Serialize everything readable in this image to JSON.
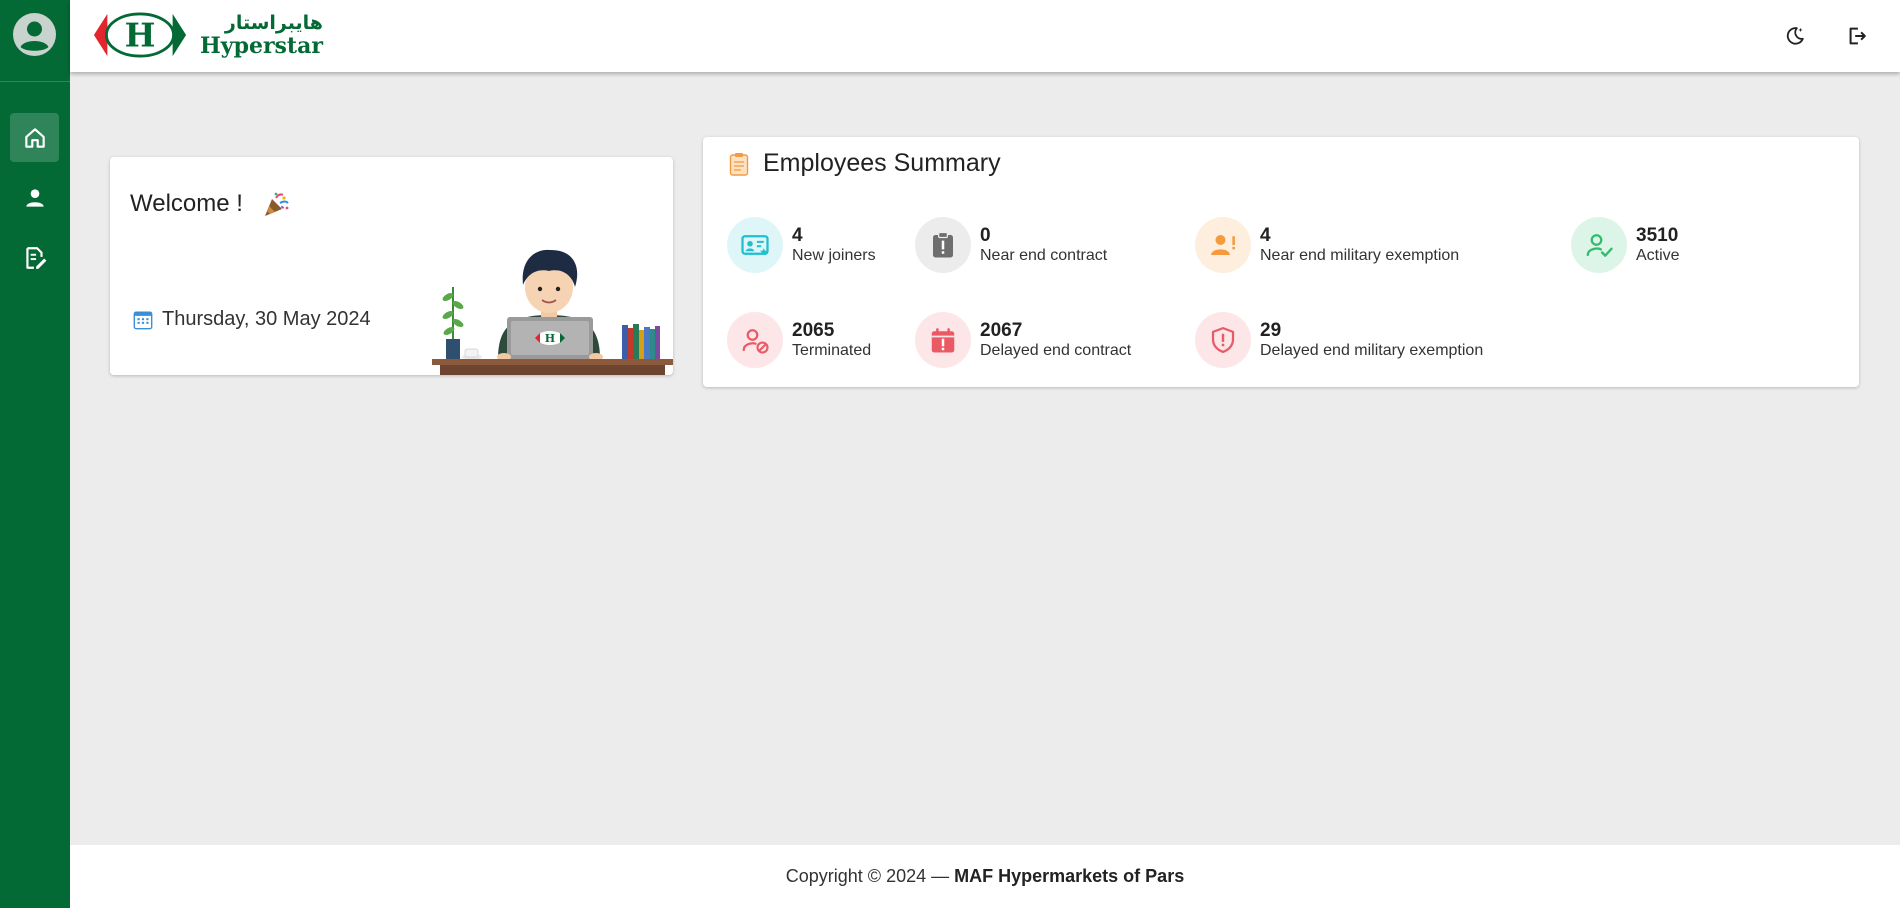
{
  "app": {
    "logo_arabic": "هايبراستار",
    "logo_latin": "Hyperstar"
  },
  "sidebar": {
    "items": [
      {
        "name": "home",
        "icon": "home-icon",
        "active": true
      },
      {
        "name": "profile",
        "icon": "person-icon",
        "active": false
      },
      {
        "name": "requests",
        "icon": "edit-document-icon",
        "active": false
      }
    ]
  },
  "topbar": {
    "theme_icon": "moon-icon",
    "logout_icon": "logout-icon"
  },
  "welcome": {
    "title": "Welcome !",
    "date": "Thursday, 30 May 2024"
  },
  "summary": {
    "title": "Employees Summary",
    "stats": [
      {
        "value": "4",
        "label": "New joiners",
        "icon": "id-card-icon",
        "color": "#1dbfd1",
        "bg": "#dff6f9"
      },
      {
        "value": "0",
        "label": "Near end contract",
        "icon": "clipboard-alert-icon",
        "color": "#6e6e6e",
        "bg": "#ececec"
      },
      {
        "value": "4",
        "label": "Near end military exemption",
        "icon": "person-alert-icon",
        "color": "#f59a3e",
        "bg": "#fdeedd"
      },
      {
        "value": "3510",
        "label": "Active",
        "icon": "person-check-icon",
        "color": "#2fbd6b",
        "bg": "#ddf5e8"
      },
      {
        "value": "2065",
        "label": "Terminated",
        "icon": "person-blocked-icon",
        "color": "#ea5a65",
        "bg": "#fde6e8"
      },
      {
        "value": "2067",
        "label": "Delayed end contract",
        "icon": "calendar-alert-icon",
        "color": "#ea5a65",
        "bg": "#fde6e8"
      },
      {
        "value": "29",
        "label": "Delayed end military exemption",
        "icon": "shield-alert-icon",
        "color": "#ea5a65",
        "bg": "#fde6e8"
      }
    ]
  },
  "footer": {
    "copyright": "Copyright © 2024 —",
    "company": "MAF Hypermarkets of Pars"
  }
}
